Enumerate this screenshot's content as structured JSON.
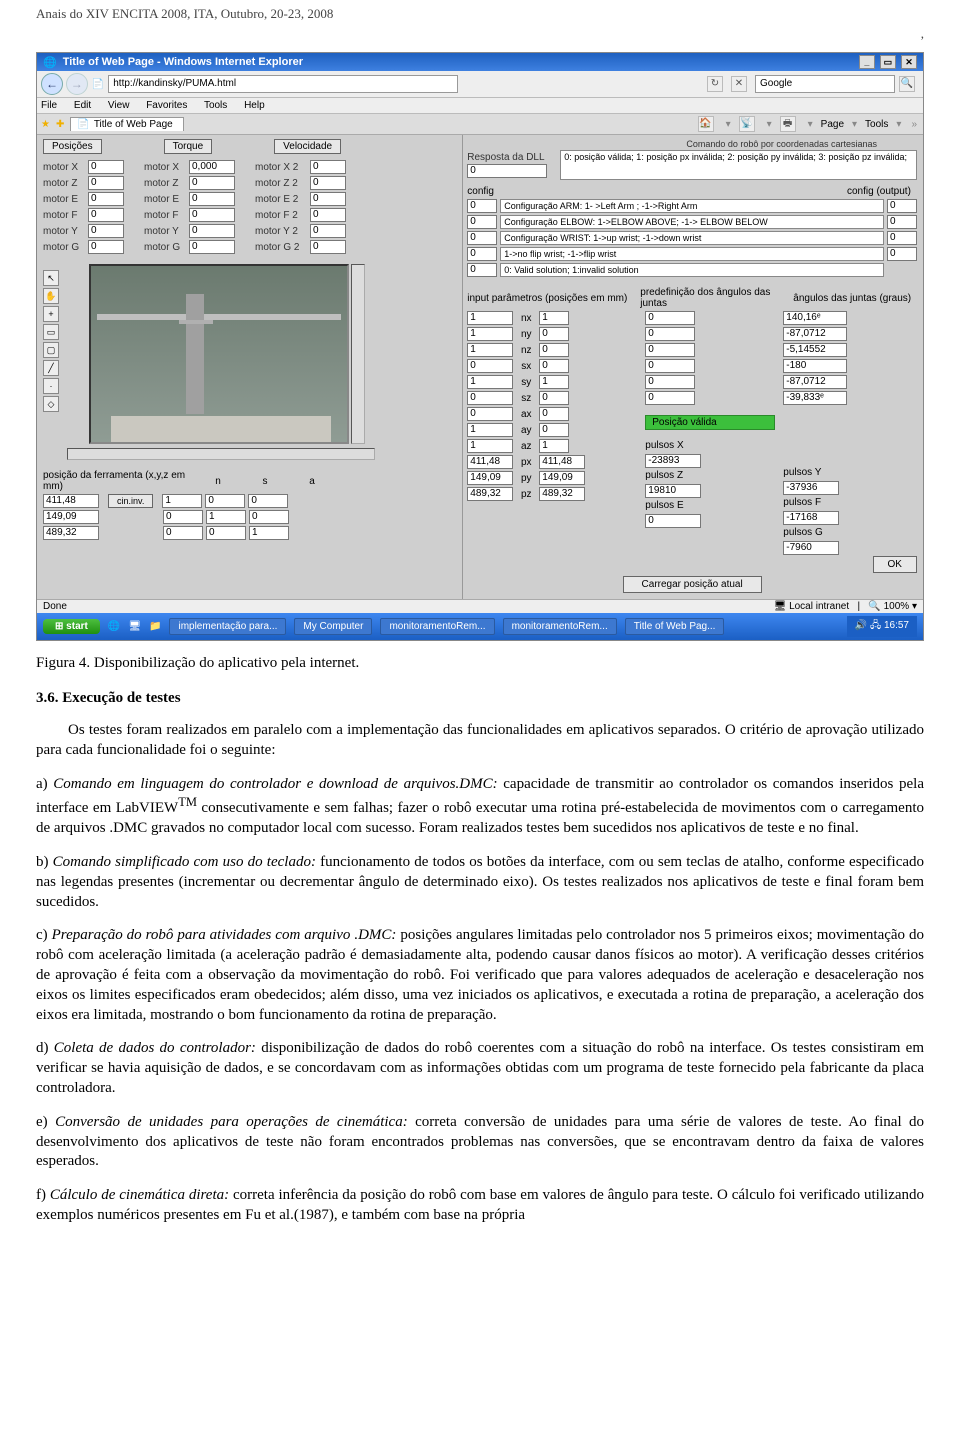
{
  "header_line": "Anais do XIV ENCITA 2008, ITA, Outubro, 20-23, 2008",
  "comma_floater": ",",
  "ie": {
    "title": "Title of Web Page - Windows Internet Explorer",
    "url": "http://kandinsky/PUMA.html",
    "search_engine": "Google",
    "menu": [
      "File",
      "Edit",
      "View",
      "Favorites",
      "Tools",
      "Help"
    ],
    "tab_label": "Title of Web Page",
    "tb_right": [
      "Page",
      "Tools"
    ],
    "status_done": "Done",
    "status_zone": "Local intranet",
    "status_zoom": "100%"
  },
  "left": {
    "head_buttons": [
      "Posições",
      "Torque",
      "Velocidade"
    ],
    "cols_h": [
      "Posições",
      "Torque",
      "Velocidade"
    ],
    "motor_labels": [
      "motor X",
      "motor Z",
      "motor E",
      "motor F",
      "motor Y",
      "motor G"
    ],
    "col1": [
      "0",
      "0",
      "0",
      "0",
      "0",
      "0"
    ],
    "col2_labels": [
      "motor X",
      "motor Z",
      "motor E",
      "motor F",
      "motor Y",
      "motor G"
    ],
    "col2_vals": [
      "0,000",
      "0",
      "0",
      "0",
      "0",
      "0"
    ],
    "col3_labels": [
      "motor X 2",
      "motor Z 2",
      "motor E 2",
      "motor F 2",
      "motor Y 2",
      "motor G 2"
    ],
    "col3_vals": [
      "0",
      "0",
      "0",
      "0",
      "0",
      "0"
    ],
    "pos_ferr_label": "posição da ferramenta (x,y,z em mm)",
    "xyz_labels": [
      "n",
      "s",
      "a"
    ],
    "xyz_vals": [
      "411,48",
      "149,09",
      "489,32"
    ],
    "cin_inv": "cin.inv.",
    "nsa_rows": [
      [
        "1",
        "0",
        "0"
      ],
      [
        "0",
        "1",
        "0"
      ],
      [
        "0",
        "0",
        "1"
      ]
    ]
  },
  "right": {
    "head_label": "Comando do robô por coordenadas cartesianas",
    "resposta_label": "Resposta da DLL",
    "resposta_val": "0",
    "codigos_resposta": "0: posição válida; 1: posição px inválida; 2: posição py inválida; 3: posição pz inválida;",
    "config_label": "config",
    "config_out_label": "config (output)",
    "config_rows": [
      {
        "v": "0",
        "desc": "Configuração ARM: 1- >Left Arm ; -1->Right Arm",
        "out": "0"
      },
      {
        "v": "0",
        "desc": "Configuração ELBOW: 1->ELBOW ABOVE; -1-> ELBOW BELOW",
        "out": "0"
      },
      {
        "v": "0",
        "desc": "Configuração WRIST: 1->up wrist; -1->down wrist",
        "out": "0"
      },
      {
        "v": "0",
        "desc": "1->no flip wrist; -1->flip wrist",
        "out": "0"
      },
      {
        "v": "0",
        "desc": "0: Valid solution; 1:invalid solution",
        "out": ""
      }
    ],
    "inputs_label": "input parâmetros (posições em mm)",
    "inputs": [
      {
        "n": "1",
        "l": "nx",
        "v": "1"
      },
      {
        "n": "1",
        "l": "ny",
        "v": "0"
      },
      {
        "n": "1",
        "l": "nz",
        "v": "0"
      },
      {
        "n": "0",
        "l": "sx",
        "v": "0"
      },
      {
        "n": "1",
        "l": "sy",
        "v": "1"
      },
      {
        "n": "0",
        "l": "sz",
        "v": "0"
      },
      {
        "n": "0",
        "l": "ax",
        "v": "0"
      },
      {
        "n": "1",
        "l": "ay",
        "v": "0"
      },
      {
        "n": "1",
        "l": "az",
        "v": "1"
      },
      {
        "n": "411,48",
        "l": "px",
        "v2": "411,48"
      },
      {
        "n": "149,09",
        "l": "py",
        "v2": "149,09"
      },
      {
        "n": "489,32",
        "l": "pz",
        "v2": "489,32"
      }
    ],
    "predef_label": "predefinição dos ângulos das juntas",
    "predef_vals": [
      "0",
      "0",
      "0",
      "0",
      "0",
      "0"
    ],
    "angulos_label": "ângulos das juntas (graus)",
    "angulos_vals": [
      "140,16ᵉ",
      "-87,0712",
      "-5,14552",
      "-180",
      "-87,0712",
      "-39,833ᵉ"
    ],
    "posicao_valida": "Posição válida",
    "pulsos": [
      {
        "l": "pulsos X",
        "v": "-23893"
      },
      {
        "l": "pulsos Y",
        "v": "-37936"
      },
      {
        "l": "pulsos Z",
        "v": "19810"
      },
      {
        "l": "pulsos F",
        "v": "-17168"
      },
      {
        "l": "pulsos E",
        "v": "0"
      },
      {
        "l": "pulsos G",
        "v": "-7960"
      }
    ],
    "ok_label": "OK",
    "carregar_label": "Carregar posição atual"
  },
  "taskbar": {
    "start": "start",
    "tasks": [
      "implementação para...",
      "My Computer",
      "monitoramentoRem...",
      "monitoramentoRem...",
      "Title of Web Pag..."
    ],
    "clock": "16:57"
  },
  "caption": "Figura 4. Disponibilização do aplicativo pela internet.",
  "section_number": "3.6. Execução de testes",
  "p1": "Os testes foram realizados em paralelo com a implementação das funcionalidades em aplicativos separados. O critério de aprovação utilizado para cada funcionalidade foi o seguinte:",
  "p2a": "a) ",
  "p2it": "Comando em linguagem do controlador e download de arquivos.DMC:",
  "p2b": " capacidade de transmitir ao controlador os comandos inseridos pela interface em LabVIEW",
  "p2sup": "TM",
  "p2c": " consecutivamente e sem falhas; fazer o robô executar uma rotina pré-estabelecida de movimentos com o carregamento de arquivos .DMC gravados no computador local com sucesso. Foram realizados testes bem sucedidos nos aplicativos de teste e no final.",
  "p3a": "b) ",
  "p3it": "Comando simplificado com uso do teclado:",
  "p3b": " funcionamento de todos os botões da interface, com ou sem teclas de atalho, conforme especificado nas legendas presentes (incrementar ou decrementar ângulo de determinado eixo). Os testes realizados nos aplicativos de teste e final foram bem sucedidos.",
  "p4a": "c) ",
  "p4it": "Preparação do robô para atividades com arquivo .DMC:",
  "p4b": " posições angulares limitadas pelo controlador nos 5 primeiros eixos; movimentação do robô com aceleração limitada (a aceleração padrão é demasiadamente alta, podendo causar danos físicos ao motor). A verificação desses critérios de aprovação é feita com a observação da movimentação do robô. Foi verificado que para valores adequados de aceleração e desaceleração nos eixos os limites especificados eram obedecidos; além disso, uma vez iniciados os aplicativos, e executada a rotina de preparação, a aceleração dos eixos era limitada, mostrando o bom funcionamento da rotina de preparação.",
  "p5a": "d) ",
  "p5it": "Coleta de dados do controlador:",
  "p5b": " disponibilização de dados do robô coerentes com a situação do robô na interface. Os testes consistiram em verificar se havia aquisição de dados, e se concordavam com as informações obtidas com um programa de teste fornecido pela fabricante da placa controladora.",
  "p6a": "e) ",
  "p6it": "Conversão de unidades para operações de cinemática:",
  "p6b": " correta conversão de unidades para uma série de valores de teste. Ao final do desenvolvimento dos aplicativos de teste não foram encontrados problemas nas conversões, que se encontravam dentro da faixa de valores esperados.",
  "p7a": "f) ",
  "p7it": "Cálculo de cinemática direta:",
  "p7b": " correta inferência da posição do robô com base em valores de ângulo para teste. O cálculo foi verificado utilizando exemplos numéricos presentes em Fu et al.(1987), e também com base na própria"
}
